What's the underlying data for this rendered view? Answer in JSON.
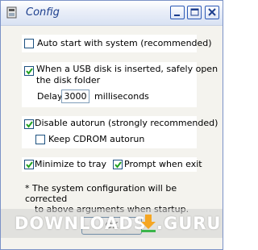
{
  "window": {
    "title": "Config"
  },
  "options": {
    "auto_start": {
      "label": "Auto start with system (recommended)",
      "checked": false
    },
    "usb_open": {
      "label_line1": "When a USB disk is inserted, safely open",
      "label_line2": "the disk folder",
      "checked": true
    },
    "delay": {
      "label": "Delay",
      "value": "3000",
      "unit": "milliseconds"
    },
    "disable_autorun": {
      "label": "Disable autorun (strongly recommended)",
      "checked": true
    },
    "keep_cdrom": {
      "label": "Keep CDROM autorun",
      "checked": false
    },
    "minimize_tray": {
      "label": "Minimize to tray",
      "checked": true
    },
    "prompt_exit": {
      "label": "Prompt when exit",
      "checked": true
    }
  },
  "note": {
    "line1": "* The system configuration will be corrected",
    "line2": "to above arguments when startup."
  },
  "ok_button": {
    "label": "OK"
  },
  "watermark": {
    "brand": "DOWNLOADS",
    "suffix": ".GURU"
  },
  "colors": {
    "title": "#1d3f8e",
    "check": "#21a121",
    "border": "#7b92c7"
  }
}
